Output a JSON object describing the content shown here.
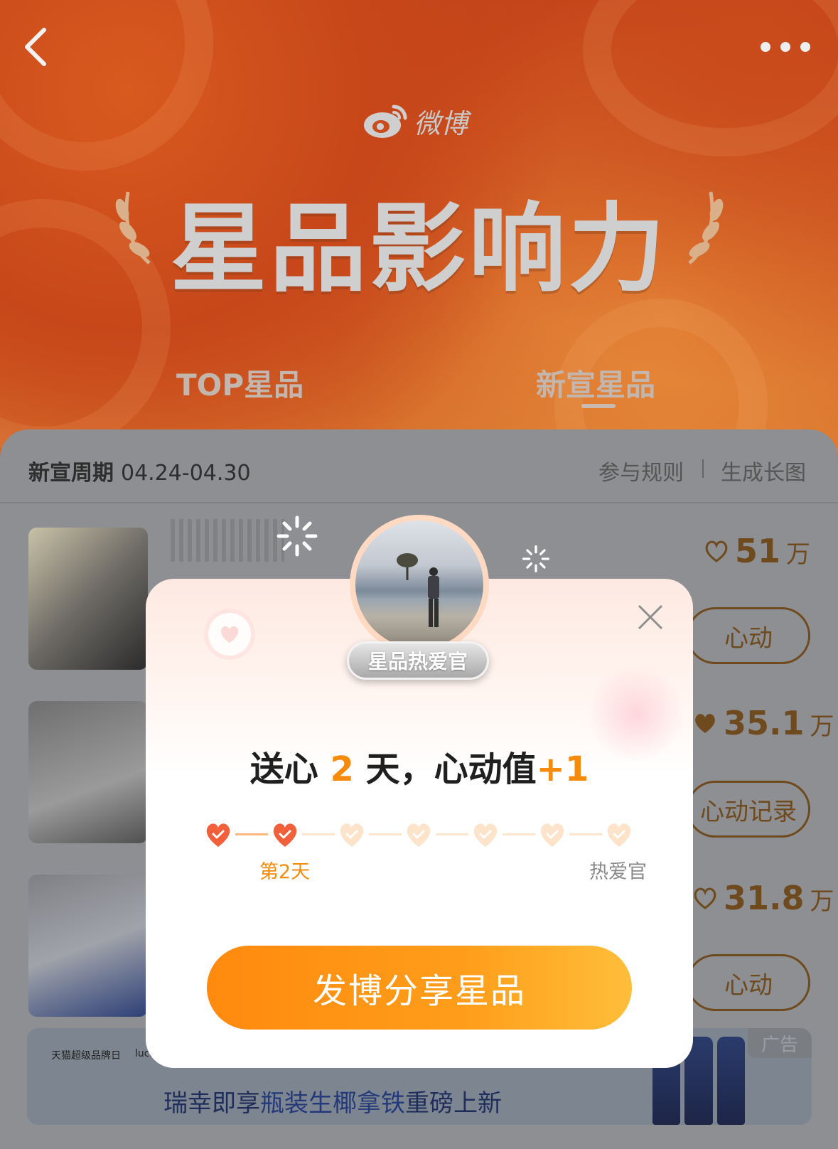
{
  "header": {
    "logo_text": "微博",
    "title": "星品影响力",
    "tabs": [
      {
        "label": "TOP星品",
        "active": false
      },
      {
        "label": "新宣星品",
        "active": true
      }
    ]
  },
  "period": {
    "label": "新宣周期",
    "dates": "04.24-04.30",
    "rules_link": "参与规则",
    "long_image_link": "生成长图"
  },
  "rows": [
    {
      "count": "51",
      "unit": "万",
      "button": "心动",
      "hearted": false
    },
    {
      "count": "35.1",
      "unit": "万",
      "button": "心动记录",
      "hearted": true
    },
    {
      "count": "31.8",
      "unit": "万",
      "button": "心动",
      "hearted": false
    }
  ],
  "ad": {
    "tag": "广告",
    "logo_left": "天猫超级品牌日",
    "logo_right": "luckin coffee",
    "text_a": "瑞幸即享",
    "text_b": "瓶装生椰拿铁",
    "text_c": "重磅上新"
  },
  "modal": {
    "badge": "星品热爱官",
    "headline_a": "送心",
    "headline_days": "2",
    "headline_b": "天，心动值",
    "headline_plus": "+1",
    "progress": {
      "completed_days": 2,
      "total_days": 7
    },
    "current_day_label": "第2天",
    "goal_label": "热爱官",
    "share_button": "发博分享星品"
  },
  "colors": {
    "accent": "#f58a0b",
    "heart_done": "#f2603b",
    "heart_pending": "#fde3c9"
  }
}
